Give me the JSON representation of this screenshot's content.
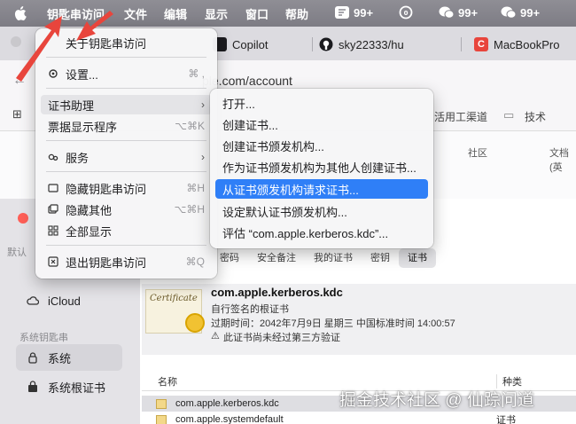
{
  "menubar": {
    "app_name": "钥匙串访问",
    "items": [
      "文件",
      "编辑",
      "显示",
      "窗口",
      "帮助"
    ],
    "tray": [
      {
        "icon": "messages-icon",
        "badge": "99+"
      },
      {
        "icon": "activity-icon",
        "badge": "0"
      },
      {
        "icon": "wechat-icon",
        "badge": "99+"
      },
      {
        "icon": "wechat-icon",
        "badge": "99+"
      }
    ]
  },
  "browser": {
    "tabs": [
      {
        "label": "Copilot",
        "icon": "copilot-icon"
      },
      {
        "label": "sky22333/hu",
        "icon": "github-icon"
      },
      {
        "label": "MacBookPro",
        "icon": "c-icon"
      }
    ],
    "url_text": "ple.com/account",
    "bookmarks": [
      "活用工渠道",
      "技术"
    ],
    "columns": [
      "社区",
      "文档(英"
    ]
  },
  "app_menu": {
    "items": [
      {
        "label": "关于钥匙串访问",
        "icon": "",
        "shortcut": ""
      },
      {
        "label": "设置...",
        "icon": "gear-icon",
        "shortcut": "⌘ ,"
      },
      {
        "label": "证书助理",
        "icon": "",
        "shortcut": ""
      },
      {
        "label": "票据显示程序",
        "icon": "",
        "shortcut": "⌥⌘K"
      },
      {
        "label": "服务",
        "icon": "services-icon",
        "shortcut": ""
      },
      {
        "label": "隐藏钥匙串访问",
        "icon": "",
        "shortcut": "⌘H"
      },
      {
        "label": "隐藏其他",
        "icon": "",
        "shortcut": "⌥⌘H"
      },
      {
        "label": "全部显示",
        "icon": "",
        "shortcut": ""
      },
      {
        "label": "退出钥匙串访问",
        "icon": "quit-icon",
        "shortcut": "⌘Q"
      }
    ]
  },
  "submenu": {
    "items": [
      "打开...",
      "创建证书...",
      "创建证书颁发机构...",
      "作为证书颁发机构为其他人创建证书...",
      "从证书颁发机构请求证书...",
      "设定默认证书颁发机构...",
      "评估 “com.apple.kerberos.kdc”..."
    ]
  },
  "keychain": {
    "sidebar": {
      "default_header": "默认",
      "icloud": "iCloud",
      "system_header": "系统钥匙串",
      "system": "系统",
      "system_roots": "系统根证书"
    },
    "tabs": [
      "密码",
      "安全备注",
      "我的证书",
      "密钥",
      "证书"
    ],
    "active_tab": "证书",
    "cert": {
      "image_text": "Certificate",
      "name": "com.apple.kerberos.kdc",
      "type": "自行签名的根证书",
      "expires": "过期时间：2042年7月9日 星期三 中国标准时间 14:00:57",
      "warning": "此证书尚未经过第三方验证"
    },
    "list": {
      "col_name": "名称",
      "col_kind": "种类",
      "rows": [
        {
          "name": "com.apple.kerberos.kdc",
          "kind": ""
        },
        {
          "name": "com.apple.systemdefault",
          "kind": "证书"
        }
      ]
    }
  },
  "watermark": "掘金技术社区 @ 仙踪问道",
  "colors": {
    "highlight": "#2f7ff7",
    "annotation": "#e8453c"
  }
}
